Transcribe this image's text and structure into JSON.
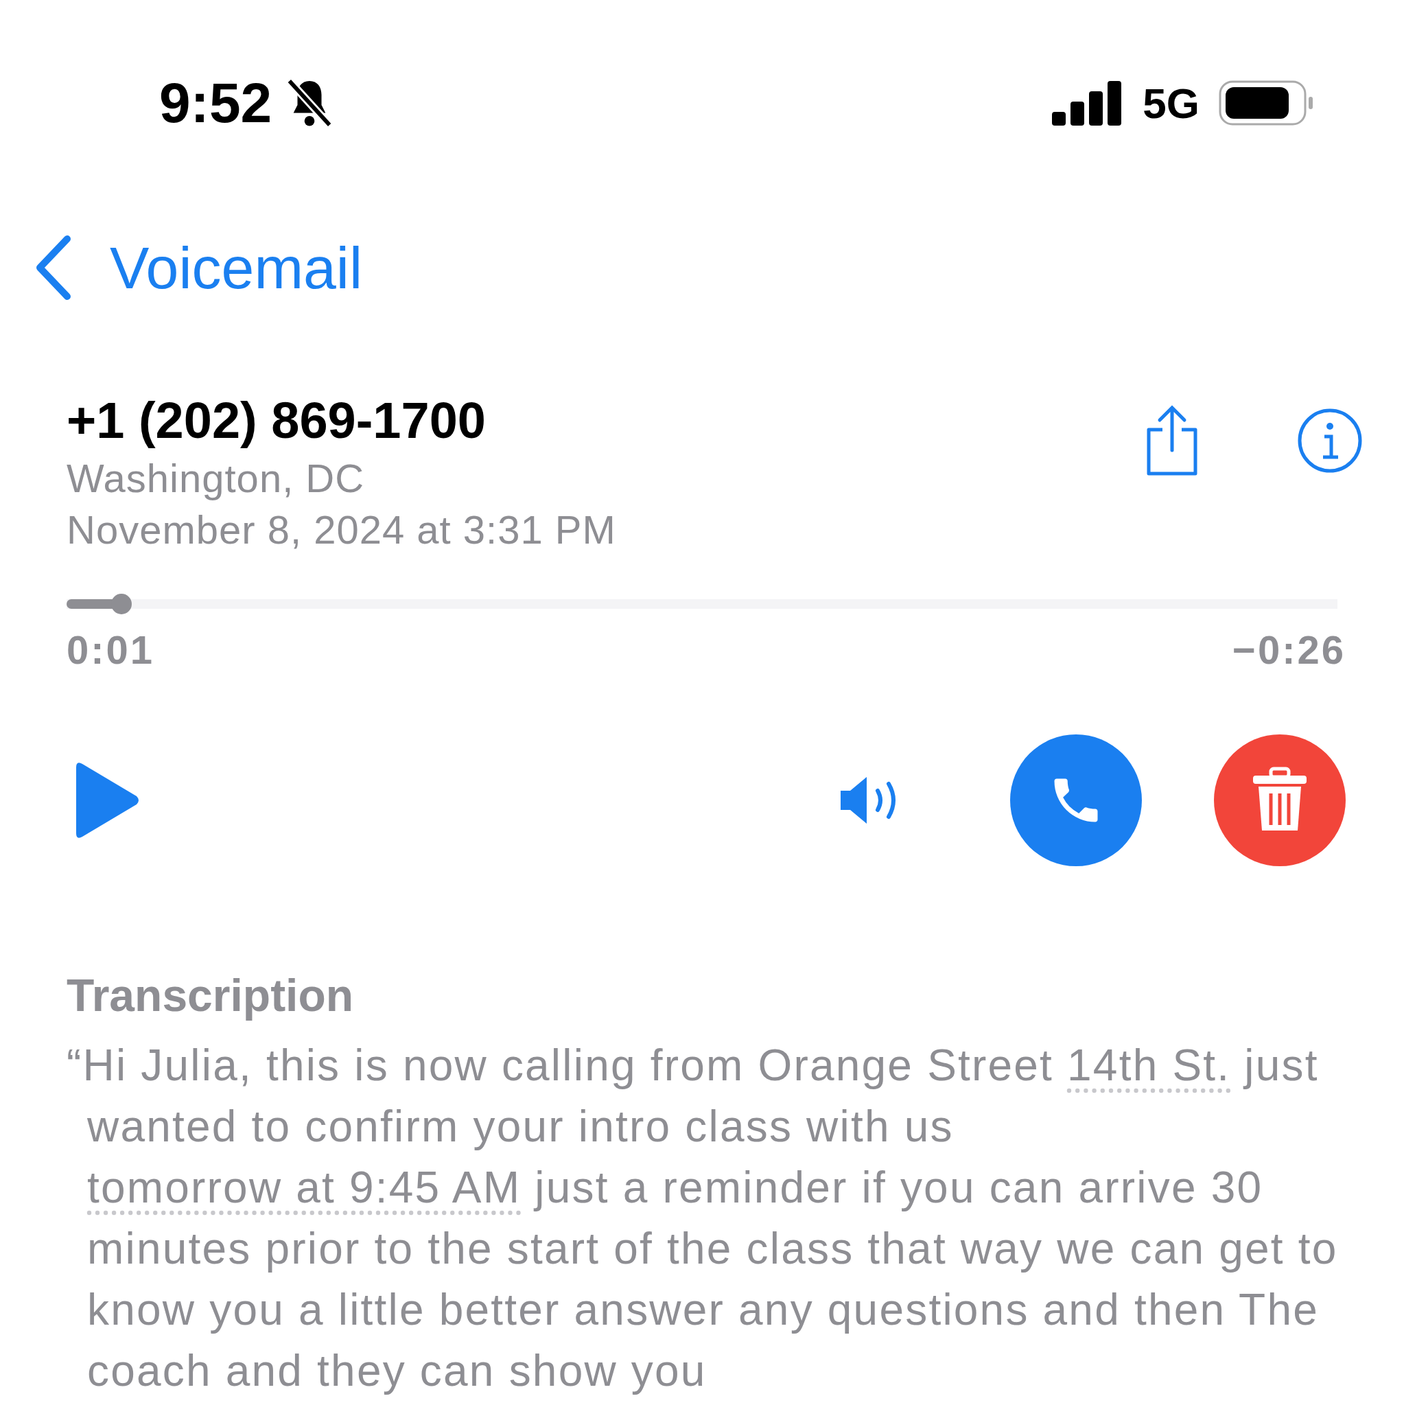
{
  "status_bar": {
    "time": "9:52",
    "silent": true,
    "network": "5G"
  },
  "nav": {
    "back_label": "Voicemail"
  },
  "voicemail": {
    "caller": "+1 (202) 869-1700",
    "location": "Washington, DC",
    "date": "November 8, 2024 at 3:31 PM"
  },
  "player": {
    "elapsed": "0:01",
    "remaining": "−0:26",
    "playing": false,
    "speaker": true
  },
  "transcription": {
    "heading": "Transcription",
    "segments": [
      {
        "kind": "text",
        "text": "“Hi Julia, this is now calling from Orange Street "
      },
      {
        "kind": "link",
        "text": "14th St."
      },
      {
        "kind": "text",
        "text": " just wanted to confirm your intro class with us "
      },
      {
        "kind": "link",
        "text": "tomorrow at 9:45 AM"
      },
      {
        "kind": "text",
        "text": " just a reminder if you can arrive 30 minutes prior to the start of the class that way we can get to know you a little better answer any questions and then The coach and they can show you"
      }
    ]
  }
}
